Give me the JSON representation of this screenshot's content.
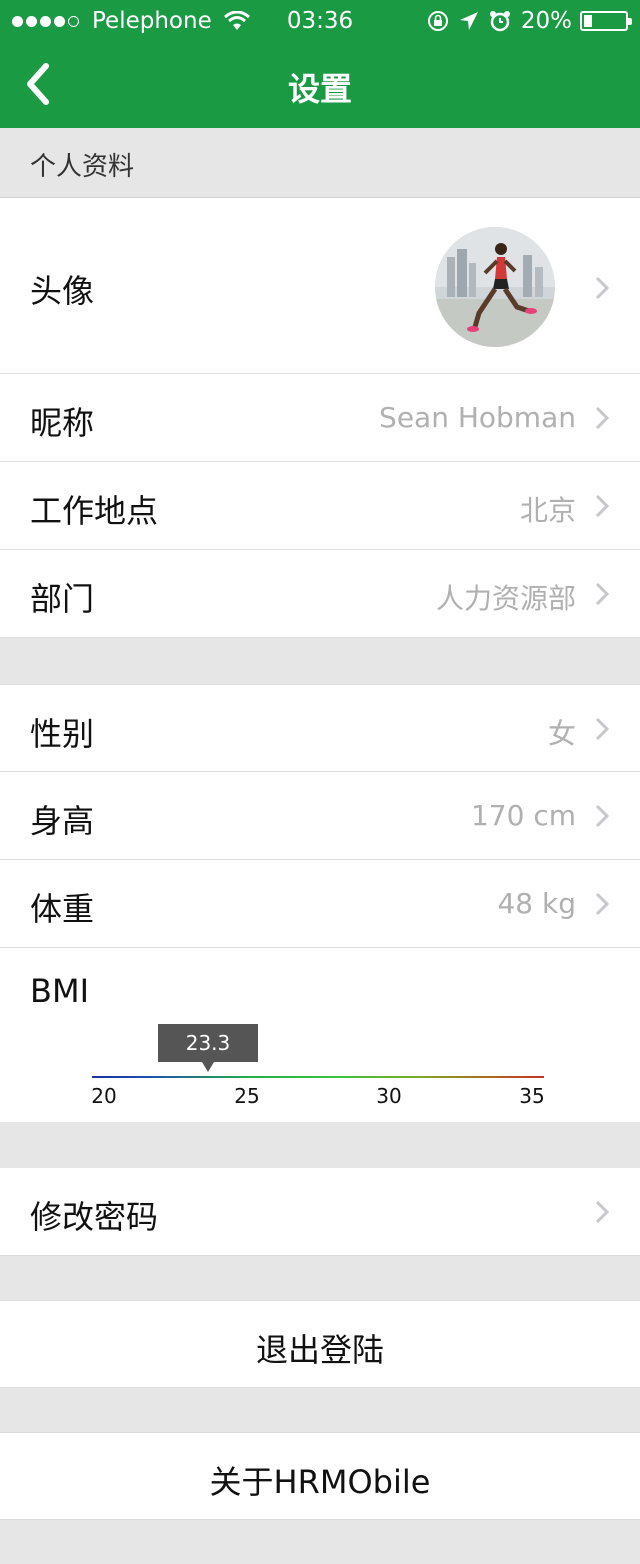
{
  "status_bar": {
    "signal_dots_filled": 4,
    "signal_dots_total": 5,
    "carrier": "Pelephone",
    "time": "03:36",
    "battery": "20%",
    "battery_level": 0.2,
    "icons": [
      "wifi-icon",
      "rotation-lock-icon",
      "location-arrow-icon",
      "alarm-icon",
      "battery-icon"
    ]
  },
  "nav": {
    "title": "设置",
    "back_icon": "chevron-left-icon"
  },
  "colors": {
    "brand_green": "#1b9a44",
    "value_gray": "#b0b0b0",
    "background": "#e6e6e6"
  },
  "section_header": "个人资料",
  "profile": {
    "avatar_label": "头像",
    "nickname_label": "昵称",
    "nickname_value": "Sean Hobman",
    "location_label": "工作地点",
    "location_value": "北京",
    "department_label": "部门",
    "department_value": "人力资源部"
  },
  "body": {
    "gender_label": "性别",
    "gender_value": "女",
    "height_label": "身高",
    "height_value": "170 cm",
    "weight_label": "体重",
    "weight_value": "48 kg",
    "bmi_label": "BMI",
    "bmi_value": "23.3",
    "bmi_scale": [
      "20",
      "25",
      "30",
      "35"
    ]
  },
  "actions": {
    "change_password": "修改密码",
    "logout": "退出登陆",
    "about": "关于HRMObile"
  }
}
